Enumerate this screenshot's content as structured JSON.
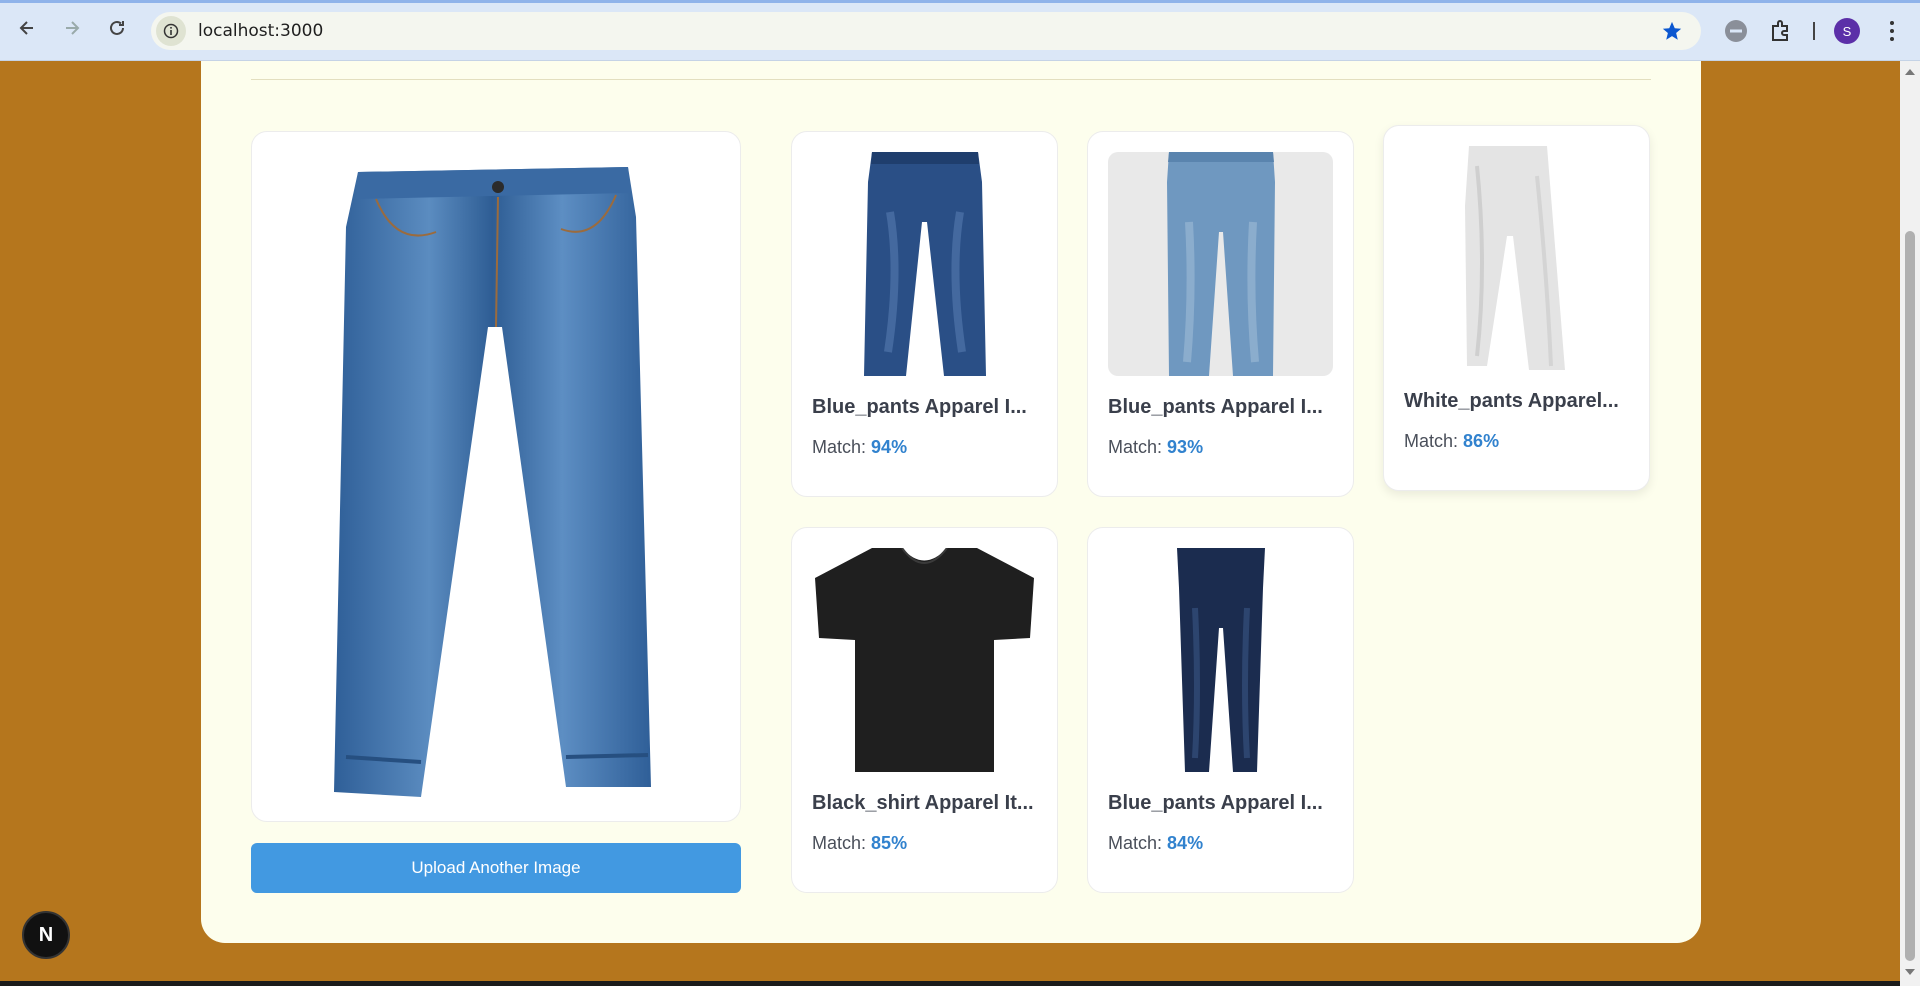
{
  "browser": {
    "url": "localhost:3000",
    "profile_initial": "S"
  },
  "results_page": {
    "upload_button_label": "Upload Another Image",
    "match_prefix": "Match:",
    "results": [
      {
        "title": "Blue_pants Apparel I...",
        "match": "94%",
        "image": "dark-blue-jeans"
      },
      {
        "title": "Blue_pants Apparel I...",
        "match": "93%",
        "image": "light-blue-jeans"
      },
      {
        "title": "White_pants Apparel...",
        "match": "86%",
        "image": "white-pants"
      },
      {
        "title": "Black_shirt Apparel It...",
        "match": "85%",
        "image": "black-tshirt"
      },
      {
        "title": "Blue_pants Apparel I...",
        "match": "84%",
        "image": "navy-skinny-jeans"
      }
    ]
  },
  "dev_badge": {
    "label": "N"
  },
  "colors": {
    "page_background": "#b5761d",
    "panel_background": "#fdfeed",
    "accent": "#4299e1",
    "match_value": "#3182ce"
  }
}
